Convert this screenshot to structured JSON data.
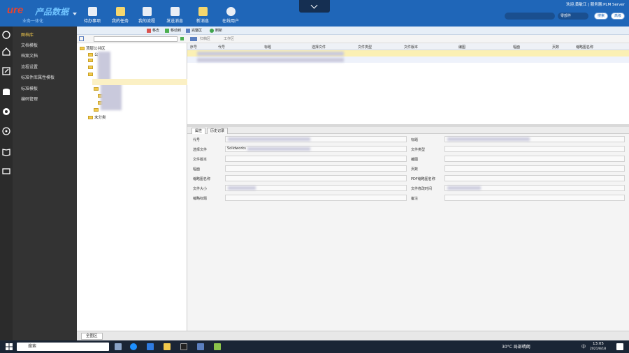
{
  "header": {
    "logo_main": "ure",
    "logo_sub": "产品数据",
    "logo_small": "业务一体化",
    "tools": [
      {
        "label": "待办事项",
        "color": "#ffffff"
      },
      {
        "label": "我的任务",
        "color": "#f5d76e"
      },
      {
        "label": "我的流程",
        "color": "#ffffff"
      },
      {
        "label": "发送消息",
        "color": "#ffffff"
      },
      {
        "label": "新消息",
        "color": "#f5d76e"
      },
      {
        "label": "在线用户",
        "color": "#ffffff"
      }
    ],
    "user_text": "欢迎,黄敏江 | 服务器:PLM Server",
    "search_select": "零部件",
    "search_btn": "搜索",
    "advanced_btn": "高级"
  },
  "nav": {
    "items": [
      {
        "label": "图档库",
        "active": true
      },
      {
        "label": "文档模板",
        "active": false
      },
      {
        "label": "档案文档",
        "active": false
      },
      {
        "label": "流程设置",
        "active": false
      },
      {
        "label": "标准件库属性模板",
        "active": false
      },
      {
        "label": "标准模板",
        "active": false
      },
      {
        "label": "编码管理",
        "active": false
      }
    ]
  },
  "toolbar": {
    "buttons": [
      "移去",
      "移动到",
      "完整区",
      "刷新"
    ],
    "grid_buttons": [
      "归档区",
      "工作区"
    ]
  },
  "tree": {
    "root": "顶层公共区",
    "nodes": [
      "公",
      "",
      "",
      "",
      "",
      "",
      "",
      "",
      "",
      "未分类"
    ]
  },
  "grid": {
    "columns": [
      "序号",
      "代号",
      "标题",
      "选择文件",
      "文件类型",
      "文件版本",
      "编图",
      "幅面",
      "页数",
      "缩略图名称"
    ]
  },
  "props": {
    "tabs": [
      "属性",
      "历史记录"
    ],
    "left_labels": [
      "代号",
      "选择文件",
      "文件版本",
      "幅面",
      "缩略图名称",
      "文件大小",
      "缩略标题"
    ],
    "right_labels": [
      "标题",
      "文件类型",
      "编图",
      "页数",
      "PDF缩略图名称",
      "文件修改时间",
      "备注"
    ],
    "select_file_value": "Solidworks"
  },
  "bottom_tab": "全图区",
  "taskbar": {
    "search": "搜索",
    "weather": "30°C 局部晴朗",
    "ime": "中",
    "time": "13:05",
    "date": "2021/8/18"
  }
}
